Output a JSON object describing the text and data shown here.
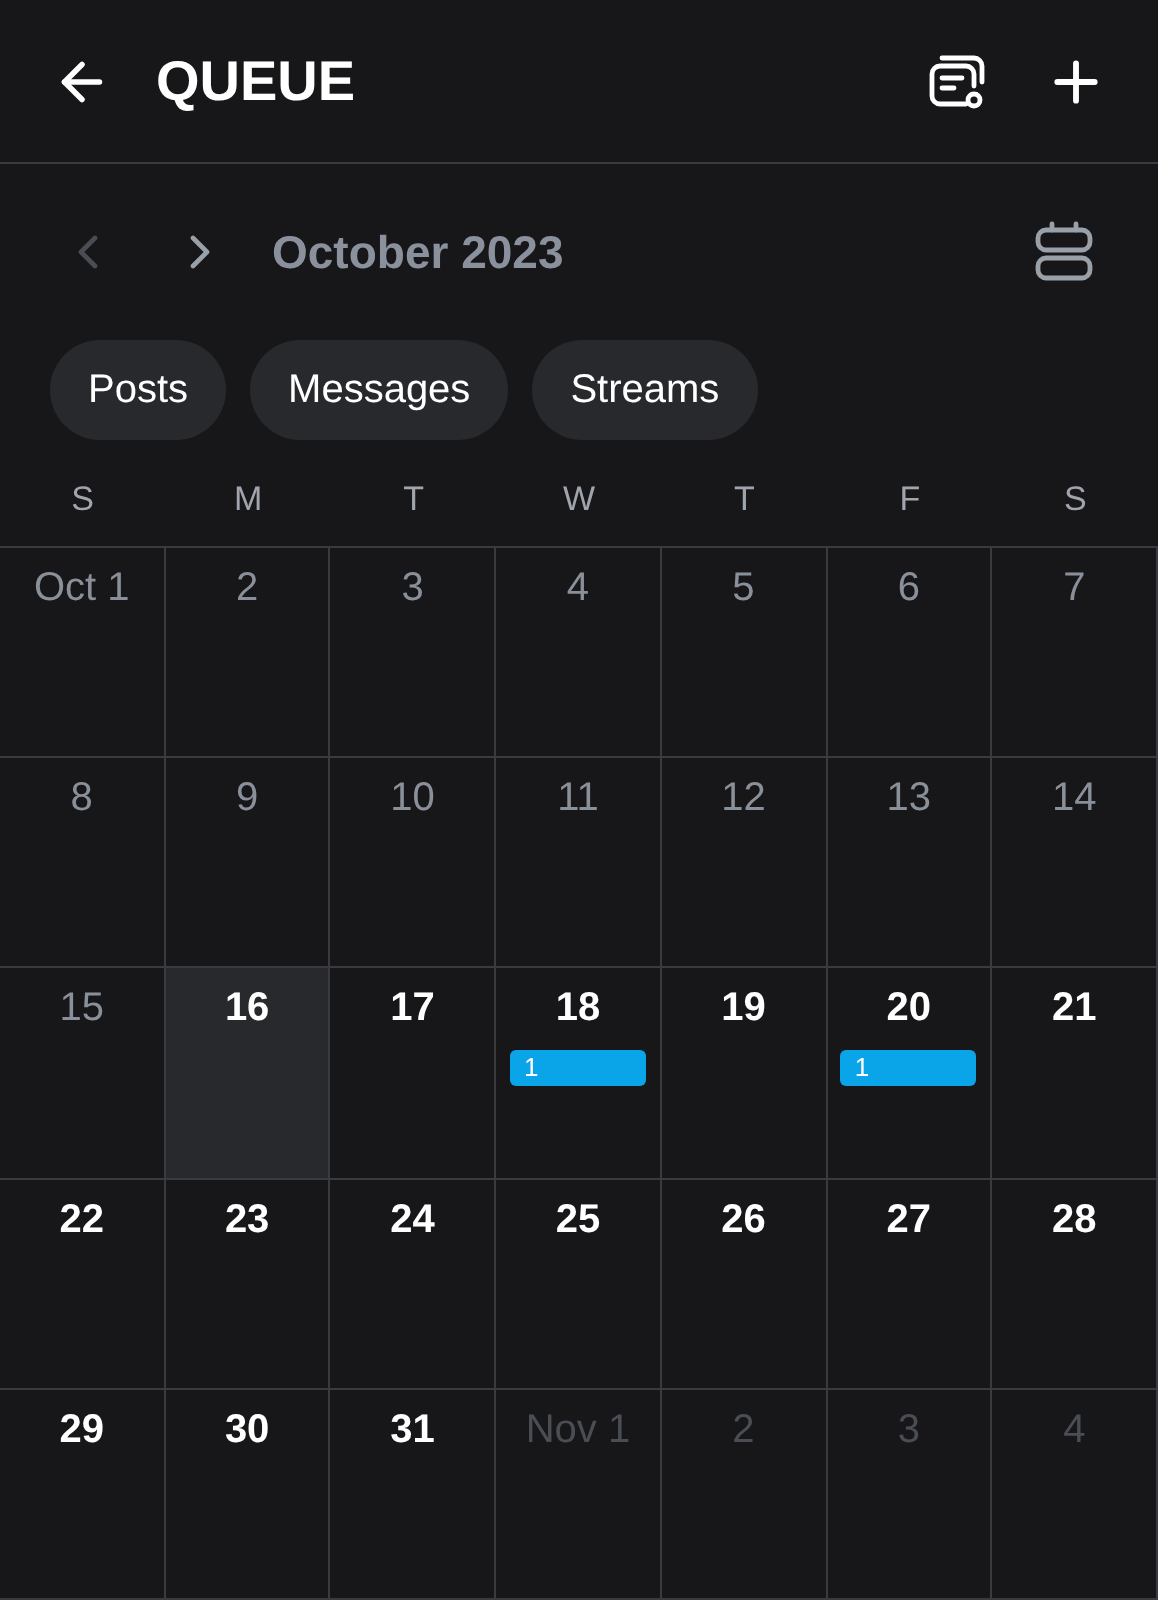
{
  "header": {
    "title": "QUEUE"
  },
  "month_nav": {
    "prev": {
      "disabled": true
    },
    "next": {
      "disabled": false
    },
    "label": "October 2023"
  },
  "filters": [
    {
      "label": "Posts",
      "selected": false
    },
    {
      "label": "Messages",
      "selected": false
    },
    {
      "label": "Streams",
      "selected": false
    }
  ],
  "weekdays": [
    "S",
    "M",
    "T",
    "W",
    "T",
    "F",
    "S"
  ],
  "weeks": [
    [
      {
        "day": "Oct 1",
        "kind": "past"
      },
      {
        "day": "2",
        "kind": "past"
      },
      {
        "day": "3",
        "kind": "past"
      },
      {
        "day": "4",
        "kind": "past"
      },
      {
        "day": "5",
        "kind": "past"
      },
      {
        "day": "6",
        "kind": "past"
      },
      {
        "day": "7",
        "kind": "past"
      }
    ],
    [
      {
        "day": "8",
        "kind": "past"
      },
      {
        "day": "9",
        "kind": "past"
      },
      {
        "day": "10",
        "kind": "past"
      },
      {
        "day": "11",
        "kind": "past"
      },
      {
        "day": "12",
        "kind": "past"
      },
      {
        "day": "13",
        "kind": "past"
      },
      {
        "day": "14",
        "kind": "past"
      }
    ],
    [
      {
        "day": "15",
        "kind": "past"
      },
      {
        "day": "16",
        "kind": "today"
      },
      {
        "day": "17",
        "kind": "future"
      },
      {
        "day": "18",
        "kind": "future",
        "events": [
          "1"
        ]
      },
      {
        "day": "19",
        "kind": "future"
      },
      {
        "day": "20",
        "kind": "future",
        "events": [
          "1"
        ]
      },
      {
        "day": "21",
        "kind": "future"
      }
    ],
    [
      {
        "day": "22",
        "kind": "future"
      },
      {
        "day": "23",
        "kind": "future"
      },
      {
        "day": "24",
        "kind": "future"
      },
      {
        "day": "25",
        "kind": "future"
      },
      {
        "day": "26",
        "kind": "future"
      },
      {
        "day": "27",
        "kind": "future"
      },
      {
        "day": "28",
        "kind": "future"
      }
    ],
    [
      {
        "day": "29",
        "kind": "future"
      },
      {
        "day": "30",
        "kind": "future"
      },
      {
        "day": "31",
        "kind": "future"
      },
      {
        "day": "Nov 1",
        "kind": "other"
      },
      {
        "day": "2",
        "kind": "other"
      },
      {
        "day": "3",
        "kind": "other"
      },
      {
        "day": "4",
        "kind": "other"
      }
    ]
  ]
}
